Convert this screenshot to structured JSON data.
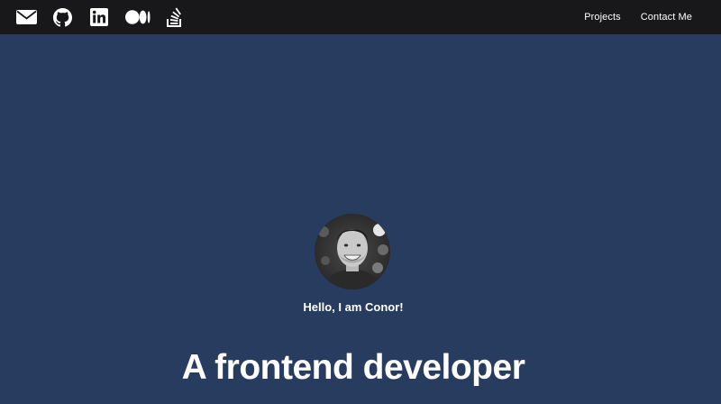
{
  "navbar": {
    "icons": [
      {
        "name": "email-icon"
      },
      {
        "name": "github-icon"
      },
      {
        "name": "linkedin-icon"
      },
      {
        "name": "medium-icon"
      },
      {
        "name": "stackoverflow-icon"
      }
    ],
    "links": [
      {
        "label": "Projects"
      },
      {
        "label": "Contact Me"
      }
    ]
  },
  "hero": {
    "greeting": "Hello, I am Conor!",
    "headline": "A frontend developer"
  },
  "colors": {
    "navbar_bg": "#18181a",
    "hero_bg": "#273c5e",
    "text": "#ffffff"
  }
}
